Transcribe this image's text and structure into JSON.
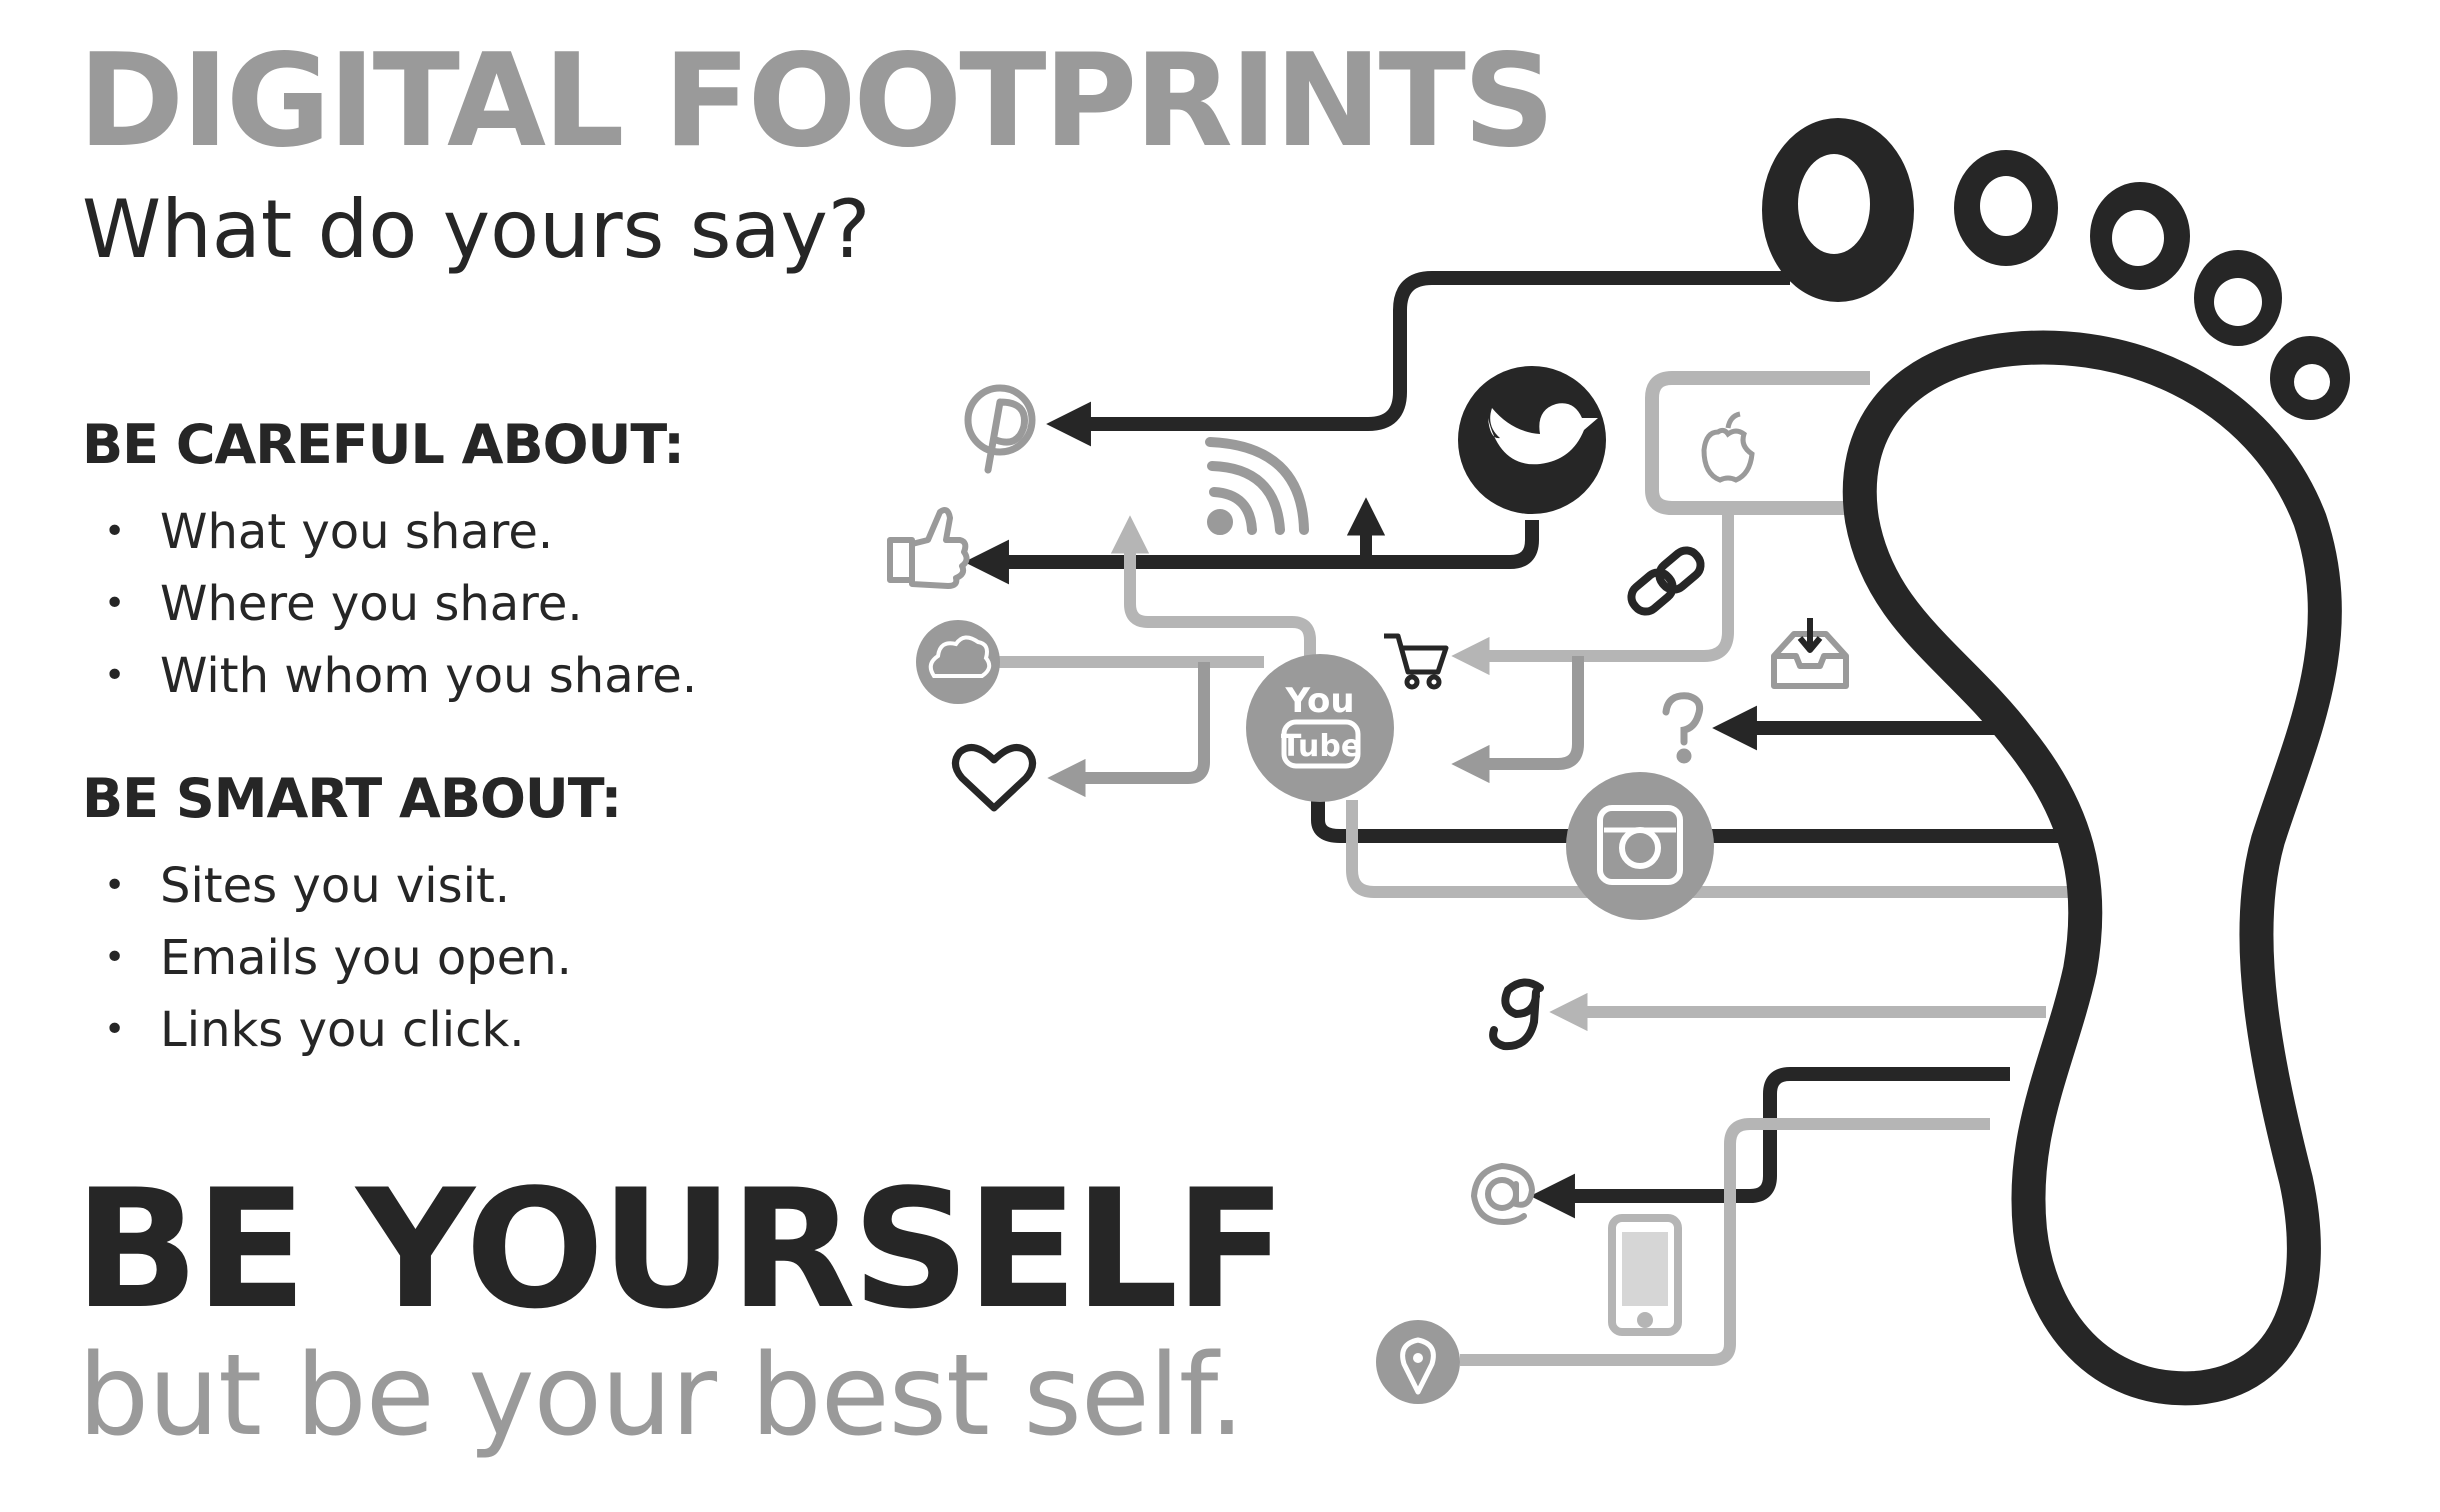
{
  "title": "DIGITAL FOOTPRINTS",
  "subtitle": "What do yours say?",
  "careful": {
    "heading": "BE CAREFUL ABOUT:",
    "items": [
      "What you share.",
      "Where you share.",
      "With whom you share."
    ]
  },
  "smart": {
    "heading": "BE SMART ABOUT:",
    "items": [
      "Sites you visit.",
      "Emails you open.",
      "Links you click."
    ]
  },
  "slogan": "BE YOURSELF",
  "tagline": "but be your best self.",
  "youtube_logo": [
    "You",
    "Tube"
  ],
  "colors": {
    "dark": "#262626",
    "mid": "#9a9a9a",
    "light": "#bdbdbd",
    "background": "#ffffff"
  },
  "icons": [
    "pinterest-icon",
    "twitter-icon",
    "apple-icon",
    "rss-icon",
    "thumbs-up-icon",
    "link-icon",
    "cloud-icon",
    "shopping-cart-icon",
    "download-icon",
    "youtube-icon",
    "question-icon",
    "heart-icon",
    "instagram-icon",
    "google-icon",
    "at-icon",
    "mobile-phone-icon",
    "location-pin-icon",
    "footprint-icon"
  ]
}
